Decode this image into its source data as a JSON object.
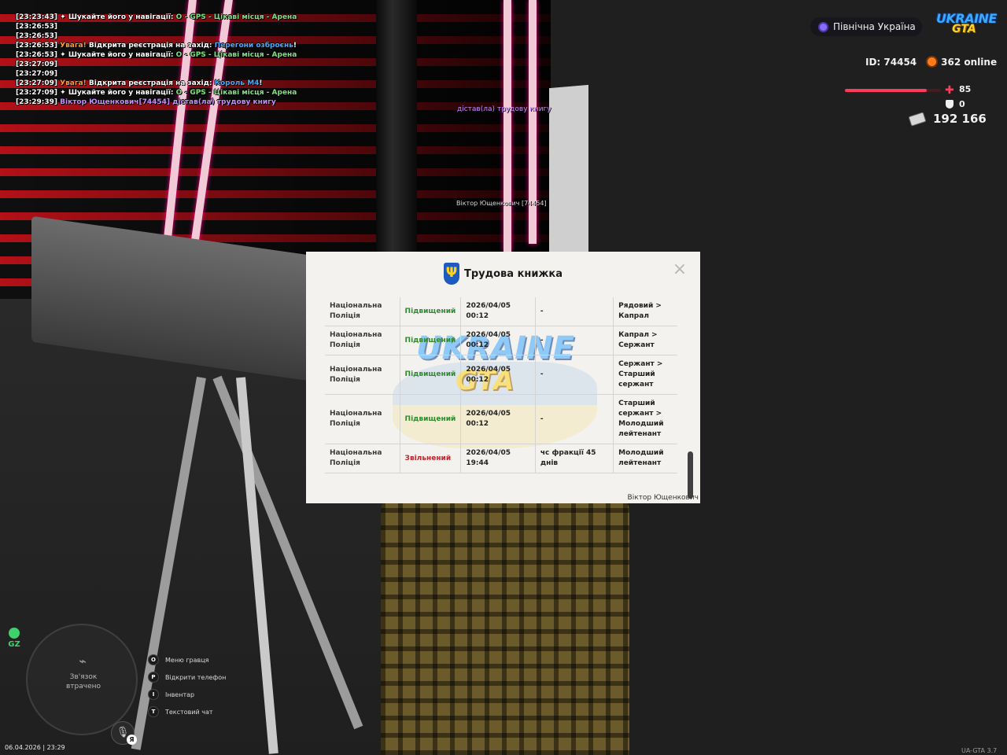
{
  "chat": [
    [
      {
        "t": "[23:23:43] ",
        "c": "c-time"
      },
      {
        "t": "✦ Шукайте його у навігації: ",
        "c": "c-white"
      },
      {
        "t": "О - GPS - Цікаві місця - Арена",
        "c": "c-green"
      }
    ],
    [
      {
        "t": "[23:26:53]",
        "c": "c-time"
      }
    ],
    [
      {
        "t": "[23:26:53]",
        "c": "c-time"
      }
    ],
    [
      {
        "t": "[23:26:53] ",
        "c": "c-time"
      },
      {
        "t": "Увага! ",
        "c": "c-orange"
      },
      {
        "t": "Відкрита реєстрація на захід: ",
        "c": "c-white"
      },
      {
        "t": "Перегони озброєнь",
        "c": "c-blue"
      },
      {
        "t": "!",
        "c": "c-white"
      }
    ],
    [
      {
        "t": "[23:26:53] ",
        "c": "c-time"
      },
      {
        "t": "✦ Шукайте його у навігації: ",
        "c": "c-white"
      },
      {
        "t": "О - GPS - Цікаві місця - Арена",
        "c": "c-green"
      }
    ],
    [
      {
        "t": "[23:27:09]",
        "c": "c-time"
      }
    ],
    [
      {
        "t": "[23:27:09]",
        "c": "c-time"
      }
    ],
    [
      {
        "t": "[23:27:09] ",
        "c": "c-time"
      },
      {
        "t": "Увага! ",
        "c": "c-orange"
      },
      {
        "t": "Відкрита реєстрація на захід: ",
        "c": "c-white"
      },
      {
        "t": "Король М4",
        "c": "c-blue"
      },
      {
        "t": "!",
        "c": "c-white"
      }
    ],
    [
      {
        "t": "[23:27:09] ",
        "c": "c-time"
      },
      {
        "t": "✦ Шукайте його у навігації: ",
        "c": "c-white"
      },
      {
        "t": "О - GPS - Цікаві місця - Арена",
        "c": "c-green"
      }
    ],
    [
      {
        "t": "[23:29:39] ",
        "c": "c-time"
      },
      {
        "t": "Віктор Ющенкович[74454] дістав(ла) трудову книгу",
        "c": "c-purple"
      }
    ]
  ],
  "world": {
    "action_text": "дістав(ла) трудову книгу",
    "player_tag": "Віктор Ющенкович [74454]"
  },
  "hud": {
    "region": "Північна Україна",
    "logo_top": "UKRAINE",
    "logo_bottom": "GTA",
    "player_id": "ID: 74454",
    "online": "362 online",
    "health": "85",
    "health_fraction": 0.85,
    "armor": "0",
    "money": "192 166",
    "gz_label": "GZ",
    "minimap_line1": "Зв'язок",
    "minimap_line2": "втрачено",
    "mic_badge": "Я",
    "datetime": "06.04.2026 | 23:29",
    "version": "UA-GTA 3.7",
    "hotkeys": [
      {
        "key": "O",
        "label": "Меню гравця"
      },
      {
        "key": "P",
        "label": "Відкрити телефон"
      },
      {
        "key": "I",
        "label": "Інвентар"
      },
      {
        "key": "T",
        "label": "Текстовий чат"
      }
    ]
  },
  "modal": {
    "title": "Трудова книжка",
    "close": "×",
    "watermark_top": "UKRAINE",
    "watermark_bottom": "GTA",
    "signature": "Віктор Ющенкович",
    "scroll_position": 0.95,
    "rows": [
      {
        "org": "Національна Поліція",
        "action": "Підвищений",
        "kind": "up",
        "date": "2026/04/05 00:12",
        "reason": "-",
        "rank": "Рядовий > Капрал"
      },
      {
        "org": "Національна Поліція",
        "action": "Підвищений",
        "kind": "up",
        "date": "2026/04/05 00:12",
        "reason": "-",
        "rank": "Капрал > Сержант"
      },
      {
        "org": "Національна Поліція",
        "action": "Підвищений",
        "kind": "up",
        "date": "2026/04/05 00:12",
        "reason": "-",
        "rank": "Сержант > Старший сержант"
      },
      {
        "org": "Національна Поліція",
        "action": "Підвищений",
        "kind": "up",
        "date": "2026/04/05 00:12",
        "reason": "-",
        "rank": "Старший сержант > Молодший лейтенант"
      },
      {
        "org": "Національна Поліція",
        "action": "Звільнений",
        "kind": "down",
        "date": "2026/04/05 19:44",
        "reason": "чс фракції 45 днів",
        "rank": "Молодший лейтенант"
      }
    ]
  }
}
